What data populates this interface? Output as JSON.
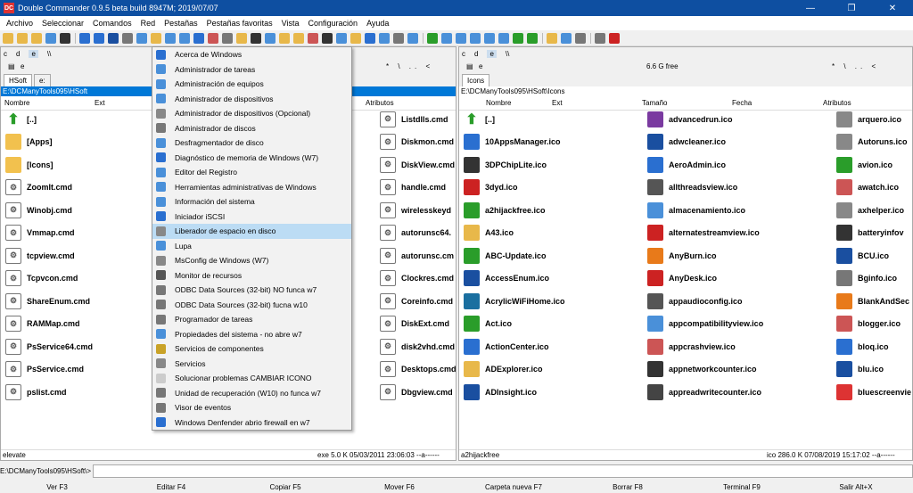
{
  "window": {
    "title": "Double Commander 0.9.5 beta build 8947M; 2019/07/07",
    "app_icon": "DC"
  },
  "menubar": [
    "Archivo",
    "Seleccionar",
    "Comandos",
    "Red",
    "Pestañas",
    "Pestañas favoritas",
    "Vista",
    "Configuración",
    "Ayuda"
  ],
  "left_panel": {
    "drives": [
      "c",
      "d",
      "e",
      "\\\\"
    ],
    "selected_drive": "e",
    "drive_label": "e",
    "nav": "*  \\  ..  <",
    "tabs": [
      "HSoft",
      "e:"
    ],
    "path": "E:\\DCManyTools095\\HSoft",
    "columns": {
      "name": "Nombre",
      "ext": "Ext",
      "attr": "Atributos"
    },
    "col1": [
      "[..]",
      "[Apps]",
      "[Icons]",
      "ZoomIt.cmd",
      "Winobj.cmd",
      "Vmmap.cmd",
      "tcpview.cmd",
      "Tcpvcon.cmd",
      "ShareEnum.cmd",
      "RAMMap.cmd",
      "PsService64.cmd",
      "PsService.cmd",
      "pslist.cmd"
    ],
    "col2": [
      "Listdlls.cmd",
      "Diskmon.cmd",
      "DiskView.cmd",
      "handle.cmd",
      "wirelesskeyd",
      "autorunsc64.",
      "autorunsc.cm",
      "Clockres.cmd",
      "Coreinfo.cmd",
      "DiskExt.cmd",
      "disk2vhd.cmd",
      "Desktops.cmd",
      "Dbgview.cmd"
    ],
    "status_name": "elevate",
    "status_info": "exe   5.0 K  05/03/2011 23:06:03  --a------"
  },
  "right_panel": {
    "drives": [
      "c",
      "d",
      "e",
      "\\\\"
    ],
    "selected_drive": "e",
    "drive_label": "e",
    "free": "6.6 G free",
    "nav": "*  \\  ..  <",
    "tabs": [
      "Icons"
    ],
    "path": "E:\\DCManyTools095\\HSoft\\Icons",
    "columns": {
      "name": "Nombre",
      "ext": "Ext",
      "size": "Tamaño",
      "date": "Fecha",
      "attr": "Atributos"
    },
    "col1": [
      "[..]",
      "10AppsManager.ico",
      "3DPChipLite.ico",
      "3dyd.ico",
      "a2hijackfree.ico",
      "A43.ico",
      "ABC-Update.ico",
      "AccessEnum.ico",
      "AcrylicWiFiHome.ico",
      "Act.ico",
      "ActionCenter.ico",
      "ADExplorer.ico",
      "ADInsight.ico"
    ],
    "col2": [
      "advancedrun.ico",
      "adwcleaner.ico",
      "AeroAdmin.ico",
      "allthreadsview.ico",
      "almacenamiento.ico",
      "alternatestreamview.ico",
      "AnyBurn.ico",
      "AnyDesk.ico",
      "appaudioconfig.ico",
      "appcompatibilityview.ico",
      "appcrashview.ico",
      "appnetworkcounter.ico",
      "appreadwritecounter.ico"
    ],
    "col3": [
      "arquero.ico",
      "Autoruns.ico",
      "avion.ico",
      "awatch.ico",
      "axhelper.ico",
      "batteryinfov",
      "BCU.ico",
      "Bginfo.ico",
      "BlankAndSec",
      "blogger.ico",
      "bloq.ico",
      "blu.ico",
      "bluescreenvie"
    ],
    "status_name": "a2hijackfree",
    "status_info": "ico   286.0 K  07/08/2019 15:17:02  --a------"
  },
  "dropdown": {
    "items": [
      "Acerca de Windows",
      "Administrador de tareas",
      "Administración de equipos",
      "Administrador de dispositivos",
      "Administrador de dispositivos (Opcional)",
      "Administrador de discos",
      "Desfragmentador de disco",
      "Diagnóstico de memoria de Windows (W7)",
      "Editor del Registro",
      "Herramientas administrativas de Windows",
      "Información del sistema",
      "Iniciador iSCSI",
      "Liberador de espacio en disco",
      "Lupa",
      "MsConfig de Windows (W7)",
      "Monitor de recursos",
      "ODBC Data Sources (32-bit) NO funca w7",
      "ODBC Data Sources (32-bit) fucna w10",
      "Programador de tareas",
      "Propiedades del sistema - no abre w7",
      "Servicios de componentes",
      "Servicios",
      "Solucionar problemas CAMBIAR ICONO",
      "Unidad de recuperación (W10) no funca w7",
      "Visor de eventos",
      "Windows Denfender abrio firewall en w7"
    ],
    "highlighted": 12
  },
  "cmdline": {
    "prompt": "E:\\DCManyTools095\\HSoft\\>",
    "value": ""
  },
  "fkeys": [
    "Ver F3",
    "Editar F4",
    "Copiar F5",
    "Mover F6",
    "Carpeta nueva F7",
    "Borrar F8",
    "Terminal F9",
    "Salir Alt+X"
  ],
  "colors": {
    "title": "#0e4fa1",
    "selection": "#0078d7",
    "highlight": "#bcdcf4"
  }
}
